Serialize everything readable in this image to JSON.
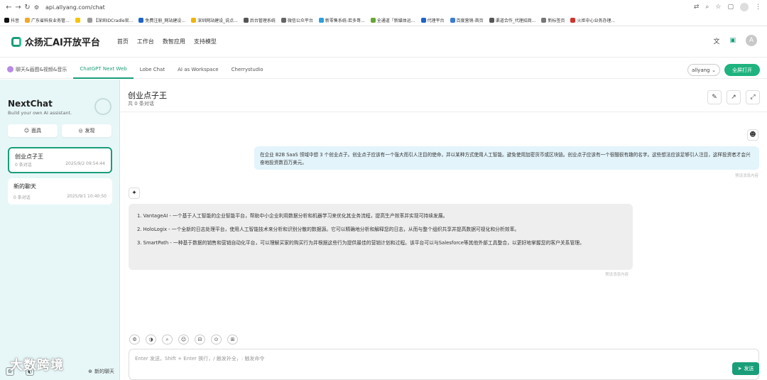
{
  "browser": {
    "url": "api.allyang.com/chat",
    "bookmarks": [
      {
        "label": "抖音",
        "color": "#111111"
      },
      {
        "label": "广东省科技业务管...",
        "color": "#f5a623"
      },
      {
        "label": "",
        "color": "#f5c400"
      },
      {
        "label": "【深圳IDCradle官...",
        "color": "#999999"
      },
      {
        "label": "免费注册_网站建设...",
        "color": "#1e63c9"
      },
      {
        "label": "深圳网站建设_说点...",
        "color": "#f0b400"
      },
      {
        "label": "后台管理系统",
        "color": "#555555"
      },
      {
        "label": "微信公众平台",
        "color": "#666666"
      },
      {
        "label": "新零售系统-若多哥...",
        "color": "#2aa0e0"
      },
      {
        "label": "全通道「新媒体运...",
        "color": "#64a832"
      },
      {
        "label": "代理平台",
        "color": "#1e63c9"
      },
      {
        "label": "百度营销-首页",
        "color": "#3a7bd5"
      },
      {
        "label": "渠道合作_代理招商...",
        "color": "#555555"
      },
      {
        "label": "新标签页",
        "color": "#777777"
      },
      {
        "label": "火炬中心业务办理...",
        "color": "#d0342c"
      }
    ]
  },
  "app": {
    "name": "众扬汇AI开放平台",
    "nav": [
      "首页",
      "工作台",
      "数智应用",
      "支持模型"
    ]
  },
  "tabs": [
    {
      "label": "聊天&画图&视频&音乐",
      "active": false
    },
    {
      "label": "ChatGPT Next Web",
      "active": true
    },
    {
      "label": "Lobe Chat",
      "active": false
    },
    {
      "label": "AI as Workspace",
      "active": false
    },
    {
      "label": "Cherrystudio",
      "active": false
    }
  ],
  "user_select": "allyang",
  "fullscreen_label": "全屏打开",
  "sidebar": {
    "title": "NextChat",
    "subtitle": "Build your own AI assistant.",
    "mask_label": "面具",
    "discover_label": "发现",
    "chats": [
      {
        "title": "创业点子王",
        "count": "0 条对话",
        "time": "2025/9/2 09:54:44",
        "active": true
      },
      {
        "title": "新的聊天",
        "count": "0 条对话",
        "time": "2025/9/1 10:40:50",
        "active": false
      }
    ],
    "new_chat_label": "新的聊天"
  },
  "chat": {
    "title": "创业点子王",
    "subtitle": "共 0 条对话",
    "user_message": "在企业 B2B SaaS 领域中想 3 个创业点子。创业点子应该有一个强大而引人注目的使命，并以某种方式使用人工智能。避免使用加密货币或区块链。创业点子应该有一个很酷很有趣的名字。这些想法应该足够引人注目，这样投资者才会兴奋地投资数百万美元。",
    "user_time": "预设消息内容",
    "bot_items": [
      "1. VantageAI - 一个基于人工智能的企业智能平台，帮助中小企业利用数据分析和机器学习来优化其业务流程，提高生产效率并实现可持续发展。",
      "2. HoloLogix - 一个全新的日志处理平台，使用人工智能技术来分析和识别分散的数据源。它可以精确地分析和解释您的日志，从而与整个组织共享并提高数据可视化和分析效率。",
      "3. SmartPath - 一种基于数据的销售和营销自动化平台，可以理解买家的购买行为并根据这些行为提供最佳的营销计划和过程。该平台可以与Salesforce等其他外部工具整合，以更好地掌握您的客户关系管理。"
    ],
    "bot_time": "预设消息内容",
    "input_placeholder": "Enter 发送，Shift + Enter 换行，/ 触发补全，: 触发命令",
    "send_label": "发送"
  },
  "watermark": "大数跨境"
}
